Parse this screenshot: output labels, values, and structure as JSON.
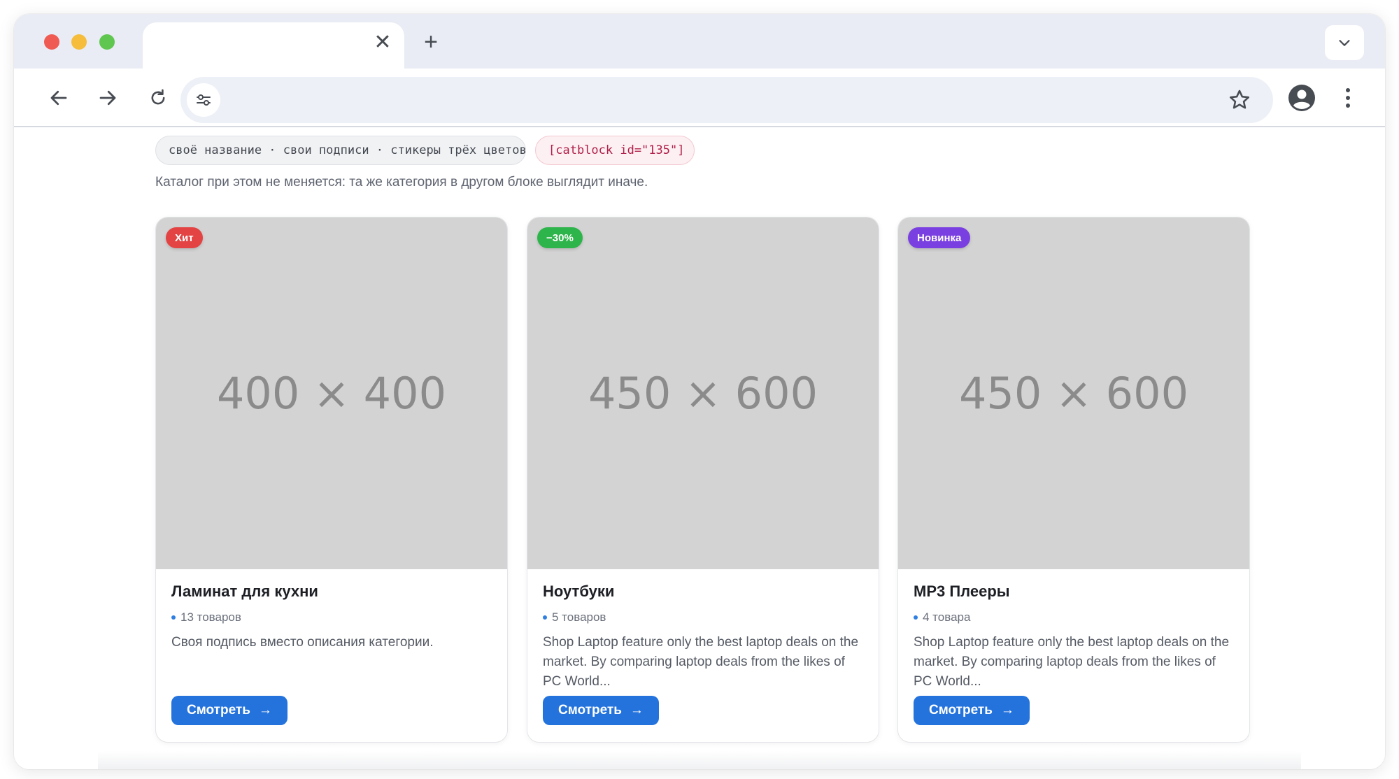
{
  "browser": {
    "tab": {
      "title": "",
      "close_icon": "close-icon"
    },
    "new_tab_icon": "plus-icon",
    "tab_menu_icon": "chevron-down-icon",
    "address": {
      "value": "",
      "placeholder": ""
    },
    "icons": [
      "back-arrow-icon",
      "forward-arrow-icon",
      "reload-icon",
      "site-settings-icon",
      "bookmark-star-icon",
      "profile-icon",
      "more-vert-icon"
    ]
  },
  "page": {
    "chips": {
      "features": "своё название · свои подписи · стикеры трёх цветов",
      "shortcode": "[catblock id=\"135\"]"
    },
    "note": "Каталог при этом не меняется: та же категория в другом блоке выглядит иначе."
  },
  "cards": [
    {
      "placeholder": "400 × 400",
      "badge": "Хит",
      "badge_color": "#e34343",
      "title": "Ламинат для кухни",
      "count": "13 товаров",
      "description": "Своя подпись вместо описания категории.",
      "button": "Смотреть",
      "button_arrow": "→"
    },
    {
      "placeholder": "450 × 600",
      "badge": "−30%",
      "badge_color": "#2db44a",
      "title": "Ноутбуки",
      "count": "5 товаров",
      "description": "Shop Laptop feature only the best laptop deals on the market. By comparing laptop deals from the likes of PC World...",
      "button": "Смотреть",
      "button_arrow": "→"
    },
    {
      "placeholder": "450 × 600",
      "badge": "Новинка",
      "badge_color": "#7a3fe0",
      "title": "MP3 Плееры",
      "count": "4 товара",
      "description": "Shop Laptop feature only the best laptop deals on the market. By comparing laptop deals from the likes of PC World...",
      "button": "Смотреть",
      "button_arrow": "→"
    }
  ],
  "colors": {
    "accent": "#2473dd",
    "tab_strip": "#e9ecf4",
    "placeholder_bg": "#d3d3d3"
  }
}
